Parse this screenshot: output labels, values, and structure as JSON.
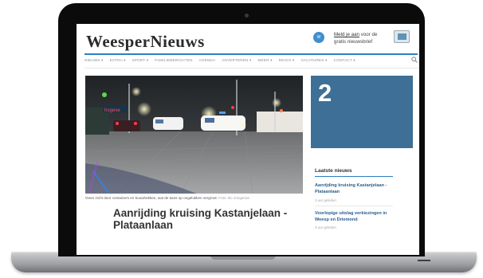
{
  "site": {
    "logo": "WeesperNieuws",
    "avatar_text": "W",
    "newsletter_link": "Meld je aan",
    "newsletter_rest": " voor de gratis nieuwsbrief"
  },
  "nav": {
    "items": [
      "NIEUWS ▾",
      "EXTRA ▾",
      "SPORT ▾",
      "FAMILIEBERICHTEN",
      "AGENDA",
      "ADVERTEREN ▾",
      "MEER ▾",
      "REGIO ▾",
      "VACATURES ▾",
      "CONTACT ▾"
    ]
  },
  "hero": {
    "sign_text": "hogeve",
    "caption": "Geen zicht door containers en bouwhekken, wat de kans op ongelukken vergroot.",
    "credit": "Foto: Bo Jongerius",
    "headline": "Aanrijding kruising Kastanjelaan - Plataanlaan"
  },
  "ad": {
    "number": "2",
    "color": "#3e6f96"
  },
  "latest": {
    "title": "Laatste nieuws",
    "items": [
      {
        "title": "Aanrijding kruising Kastanjelaan - Plataanlaan",
        "time": "3 uur geleden"
      },
      {
        "title": "Voorlopige uitslag verkiezingen in Weesp en Driemond",
        "time": "3 uur geleden"
      }
    ]
  },
  "colors": {
    "accent": "#2d7fc0",
    "link": "#2c5d8c"
  }
}
